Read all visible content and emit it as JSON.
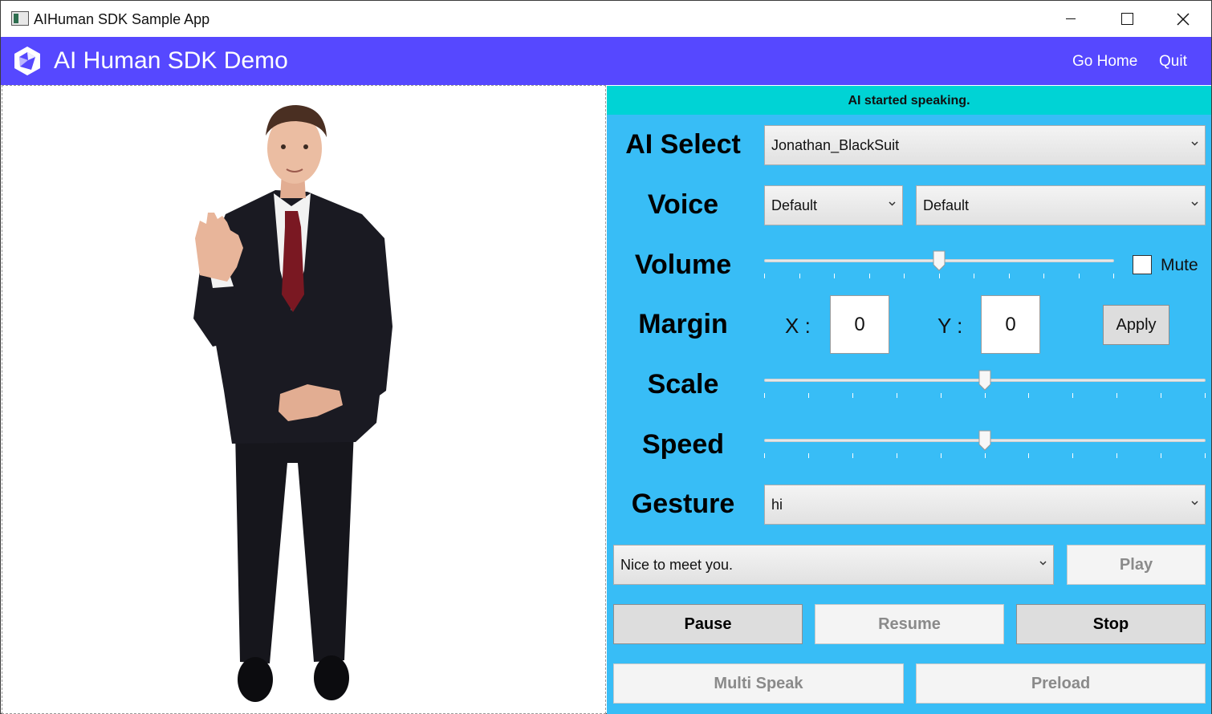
{
  "window": {
    "title": "AIHuman SDK Sample App"
  },
  "header": {
    "title": "AI Human SDK Demo",
    "nav": {
      "home": "Go Home",
      "quit": "Quit"
    },
    "color": "#5648ff"
  },
  "status": {
    "message": "AI started speaking.",
    "color": "#00d3d5"
  },
  "controls": {
    "panel_color": "#38bdf6",
    "ai_select": {
      "label": "AI Select",
      "value": "Jonathan_BlackSuit"
    },
    "voice": {
      "label": "Voice",
      "language": "Default",
      "voice_name": "Default"
    },
    "volume": {
      "label": "Volume",
      "level": 0.5,
      "mute_label": "Mute",
      "muted": false
    },
    "margin": {
      "label": "Margin",
      "x_label": "X :",
      "x_value": "0",
      "y_label": "Y :",
      "y_value": "0",
      "apply_label": "Apply"
    },
    "scale": {
      "label": "Scale",
      "level": 0.5
    },
    "speed": {
      "label": "Speed",
      "level": 0.5
    },
    "gesture": {
      "label": "Gesture",
      "value": "hi"
    },
    "sentence": {
      "value": "Nice to meet you.",
      "play_label": "Play"
    },
    "buttons": {
      "pause": "Pause",
      "resume": "Resume",
      "stop": "Stop",
      "multi_speak": "Multi Speak",
      "preload": "Preload"
    }
  },
  "icons": {
    "app": "window-app-icon",
    "logo": "cube-logo-icon",
    "dropdown": "chevron-down-icon"
  }
}
